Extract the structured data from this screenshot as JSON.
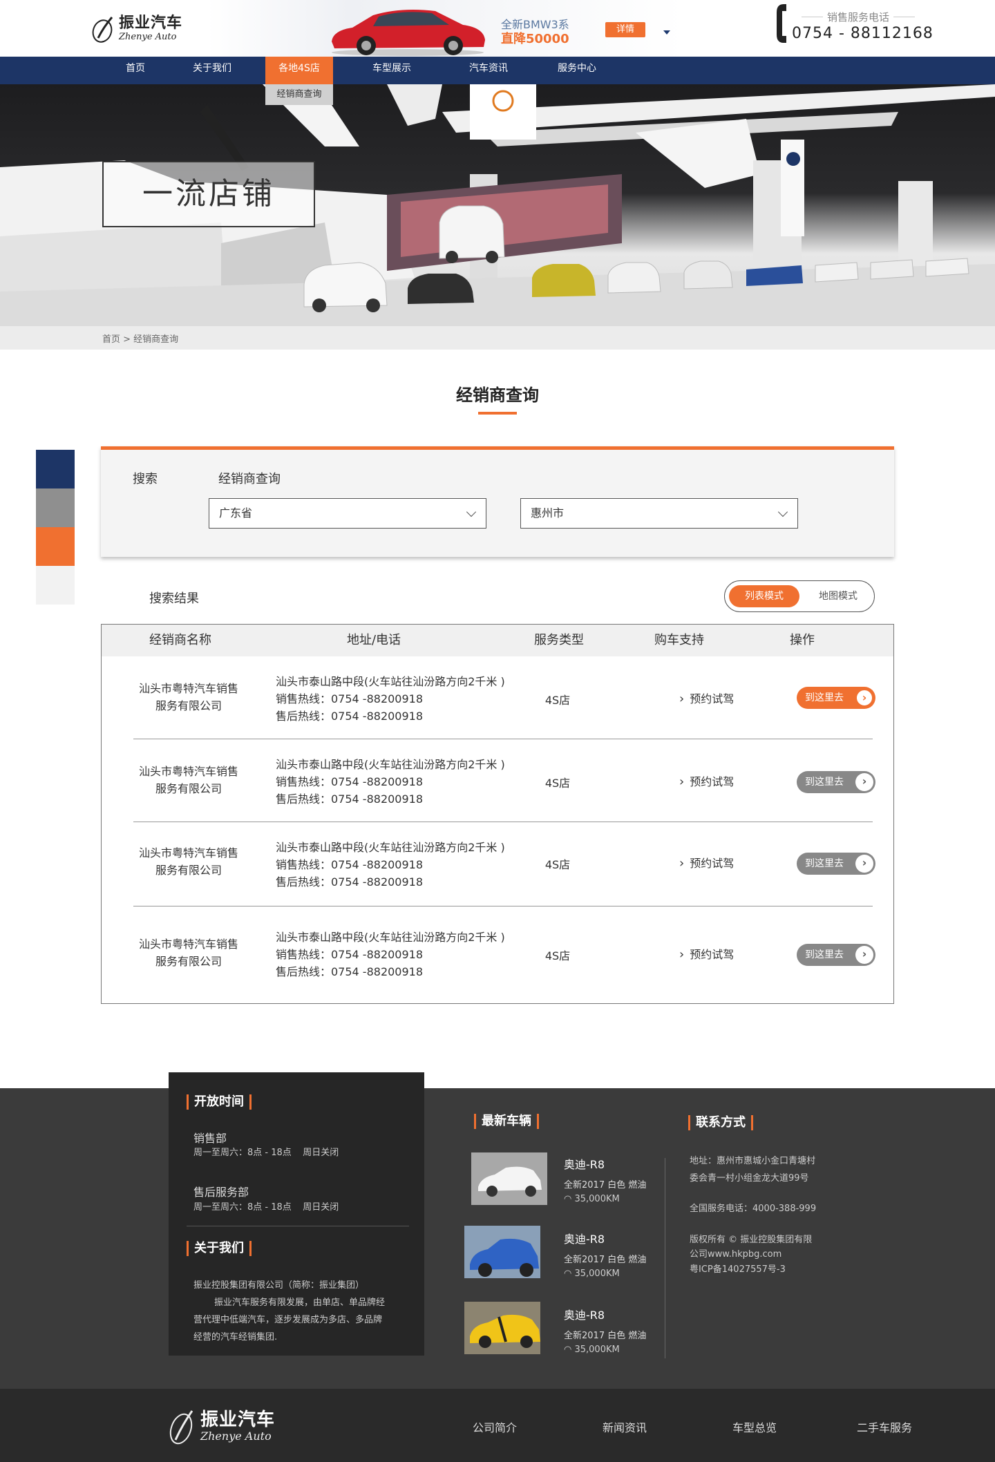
{
  "header": {
    "logo_cn": "振业汽车",
    "logo_en": "Zhenye Auto",
    "promo_model": "全新BMW3系",
    "promo_price": "直降50000",
    "promo_button": "详情",
    "phone_label": "销售服务电话",
    "phone_number": "0754 - 88112168"
  },
  "nav": {
    "items": [
      "首页",
      "关于我们",
      "各地4S店",
      "车型展示",
      "汽车资讯",
      "服务中心"
    ],
    "active_index": 2,
    "dropdown_item": "经销商查询"
  },
  "banner": {
    "title": "一流店铺"
  },
  "breadcrumb": "首页 > 经销商查询",
  "section_title": "经销商查询",
  "search": {
    "label": "搜索",
    "dealer_label": "经销商查询",
    "province": "广东省",
    "city": "惠州市"
  },
  "results": {
    "label": "搜索结果",
    "mode_list": "列表模式",
    "mode_map": "地图模式",
    "columns": [
      "经销商名称",
      "地址/电话",
      "服务类型",
      "购车支持",
      "操作"
    ],
    "rows": [
      {
        "name_line1": "汕头市粤特汽车销售",
        "name_line2": "服务有限公司",
        "address": "汕头市泰山路中段(火车站往汕汾路方向2千米 )",
        "sales": "销售热线：0754 -88200918",
        "service": "售后热线：0754 -88200918",
        "type": "4S店",
        "support": "预约试驾",
        "action": "到这里去"
      },
      {
        "name_line1": "汕头市粤特汽车销售",
        "name_line2": "服务有限公司",
        "address": "汕头市泰山路中段(火车站往汕汾路方向2千米 )",
        "sales": "销售热线：0754 -88200918",
        "service": "售后热线：0754 -88200918",
        "type": "4S店",
        "support": "预约试驾",
        "action": "到这里去"
      },
      {
        "name_line1": "汕头市粤特汽车销售",
        "name_line2": "服务有限公司",
        "address": "汕头市泰山路中段(火车站往汕汾路方向2千米 )",
        "sales": "销售热线：0754 -88200918",
        "service": "售后热线：0754 -88200918",
        "type": "4S店",
        "support": "预约试驾",
        "action": "到这里去"
      },
      {
        "name_line1": "汕头市粤特汽车销售",
        "name_line2": "服务有限公司",
        "address": "汕头市泰山路中段(火车站往汕汾路方向2千米 )",
        "sales": "销售热线：0754 -88200918",
        "service": "售后热线：0754 -88200918",
        "type": "4S店",
        "support": "预约试驾",
        "action": "到这里去"
      }
    ]
  },
  "footer": {
    "hours_title": "开放时间",
    "sales_dept": "销售部",
    "sales_hours": "周一至周六：8点 - 18点    周日关闭",
    "service_dept": "售后服务部",
    "service_hours": "周一至周六：8点 - 18点    周日关闭",
    "about_title": "关于我们",
    "about_line1": "振业控股集团有限公司（简称：振业集团）",
    "about_line2": "振业汽车服务有限发展，由单店、单品牌经",
    "about_line3": "营代理中低端汽车，逐步发展成为多店、多品牌",
    "about_line4": "经营的汽车经销集团.",
    "cars_title": "最新车辆",
    "cars": [
      {
        "name": "奥迪-R8",
        "spec": "全新2017 白色 燃油",
        "km": "35,000KM"
      },
      {
        "name": "奥迪-R8",
        "spec": "全新2017 白色 燃油",
        "km": "35,000KM"
      },
      {
        "name": "奥迪-R8",
        "spec": "全新2017 白色 燃油",
        "km": "35,000KM"
      }
    ],
    "contact_title": "联系方式",
    "address_line1": "地址：惠州市惠城小金口青塘村",
    "address_line2": "委会青一村小组金龙大道99号",
    "hotline": "全国服务电话：4000-388-999",
    "copyright_line1": "版权所有 © 振业控股集团有限",
    "copyright_line2": "公司www.hkpbg.com",
    "icp": "粤ICP备14027557号-3"
  },
  "bottom": {
    "logo_cn": "振业汽车",
    "logo_en": "Zhenye Auto",
    "links": [
      "公司简介",
      "新闻资讯",
      "车型总览",
      "二手车服务"
    ]
  },
  "colors": {
    "navy": "#1d3566",
    "orange": "#f07030",
    "gray": "#888888"
  }
}
